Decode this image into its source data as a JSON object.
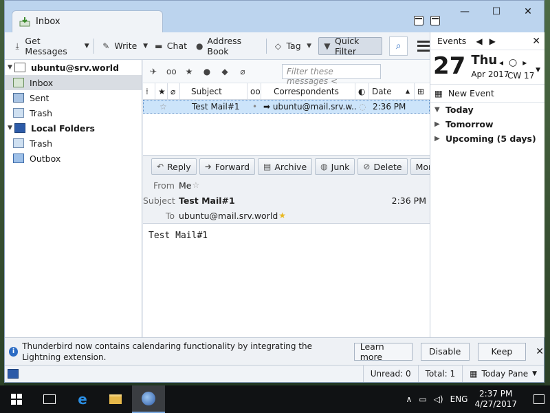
{
  "window": {
    "tab_label": "Inbox",
    "controls": {
      "minimize": "—",
      "maximize": "☐",
      "close": "✕"
    }
  },
  "toolbar": {
    "get_messages": "Get Messages",
    "write": "Write",
    "chat": "Chat",
    "address_book": "Address Book",
    "tag": "Tag",
    "quick_filter": "Quick Filter"
  },
  "folders": {
    "account": "ubuntu@srv.world",
    "inbox": "Inbox",
    "sent": "Sent",
    "trash": "Trash",
    "local_folders": "Local Folders",
    "local_trash": "Trash",
    "outbox": "Outbox"
  },
  "thread": {
    "filter_placeholder": "Filter these messages <",
    "columns": {
      "subject": "Subject",
      "correspondents": "Correspondents",
      "date": "Date"
    },
    "rows": [
      {
        "subject": "Test Mail#1",
        "correspondent": "ubuntu@mail.srv.w...",
        "date": "2:36 PM"
      }
    ]
  },
  "message": {
    "actions": {
      "reply": "Reply",
      "forward": "Forward",
      "archive": "Archive",
      "junk": "Junk",
      "delete": "Delete",
      "more": "More"
    },
    "from_label": "From",
    "from_value": "Me",
    "subject_label": "Subject",
    "subject_value": "Test Mail#1",
    "time": "2:36 PM",
    "to_label": "To",
    "to_value": "ubuntu@mail.srv.world",
    "body": "Test Mail#1"
  },
  "today_pane": {
    "title": "Events",
    "day": "27",
    "weekday": "Thu",
    "month_year": "Apr 2017",
    "cw": "CW 17",
    "new_event": "New Event",
    "today": "Today",
    "tomorrow": "Tomorrow",
    "upcoming": "Upcoming (5 days)"
  },
  "notification": {
    "text": "Thunderbird now contains calendaring functionality by integrating the Lightning extension.",
    "learn_more": "Learn more",
    "disable": "Disable",
    "keep": "Keep"
  },
  "status": {
    "unread": "Unread: 0",
    "total": "Total: 1",
    "today_pane": "Today Pane"
  },
  "taskbar": {
    "lang": "ENG",
    "time": "2:37 PM",
    "date": "4/27/2017"
  }
}
